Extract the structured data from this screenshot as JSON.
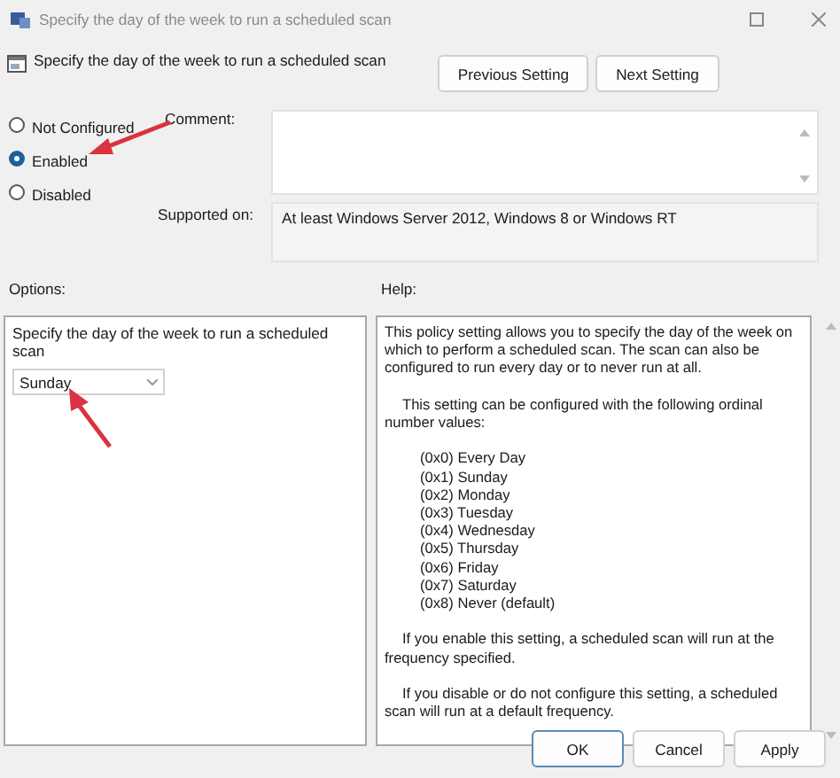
{
  "window": {
    "title": "Specify the day of the week to run a scheduled scan"
  },
  "header": {
    "title": "Specify the day of the week to run a scheduled scan",
    "buttons": [
      "Previous Setting",
      "Next Setting"
    ]
  },
  "state_options": [
    {
      "label": "Not Configured",
      "selected": false
    },
    {
      "label": "Enabled",
      "selected": true
    },
    {
      "label": "Disabled",
      "selected": false
    }
  ],
  "comment": {
    "label": "Comment:"
  },
  "supported_on": {
    "label": "Supported on:",
    "value": "At least Windows Server 2012, Windows 8 or Windows RT"
  },
  "options": {
    "label": "Options:",
    "prompt": "Specify the day of the week to run a scheduled scan",
    "dropdown": {
      "value": "Sunday"
    }
  },
  "help": {
    "label": "Help:",
    "blocks": [
      {
        "kind": "text",
        "text": "This policy setting allows you to specify the day of the week on which to perform a scheduled scan. The scan can also be configured to run every day or to never run at all."
      },
      {
        "kind": "indented",
        "text": "This setting can be configured with the following ordinal number values:"
      },
      {
        "kind": "list",
        "items": [
          "(0x0) Every Day",
          "(0x1) Sunday",
          "(0x2) Monday",
          "(0x3) Tuesday",
          "(0x4) Wednesday",
          "(0x5) Thursday",
          "(0x6) Friday",
          "(0x7) Saturday",
          "(0x8) Never (default)"
        ]
      },
      {
        "kind": "indented",
        "text": "If you enable this setting, a scheduled scan will run at the frequency specified."
      },
      {
        "kind": "indented",
        "text": "If you disable or do not configure this setting, a scheduled scan will run at a default frequency."
      }
    ]
  },
  "buttons": [
    {
      "label": "OK",
      "selected": true
    },
    {
      "label": "Cancel",
      "selected": false
    },
    {
      "label": "Apply",
      "selected": false
    }
  ]
}
